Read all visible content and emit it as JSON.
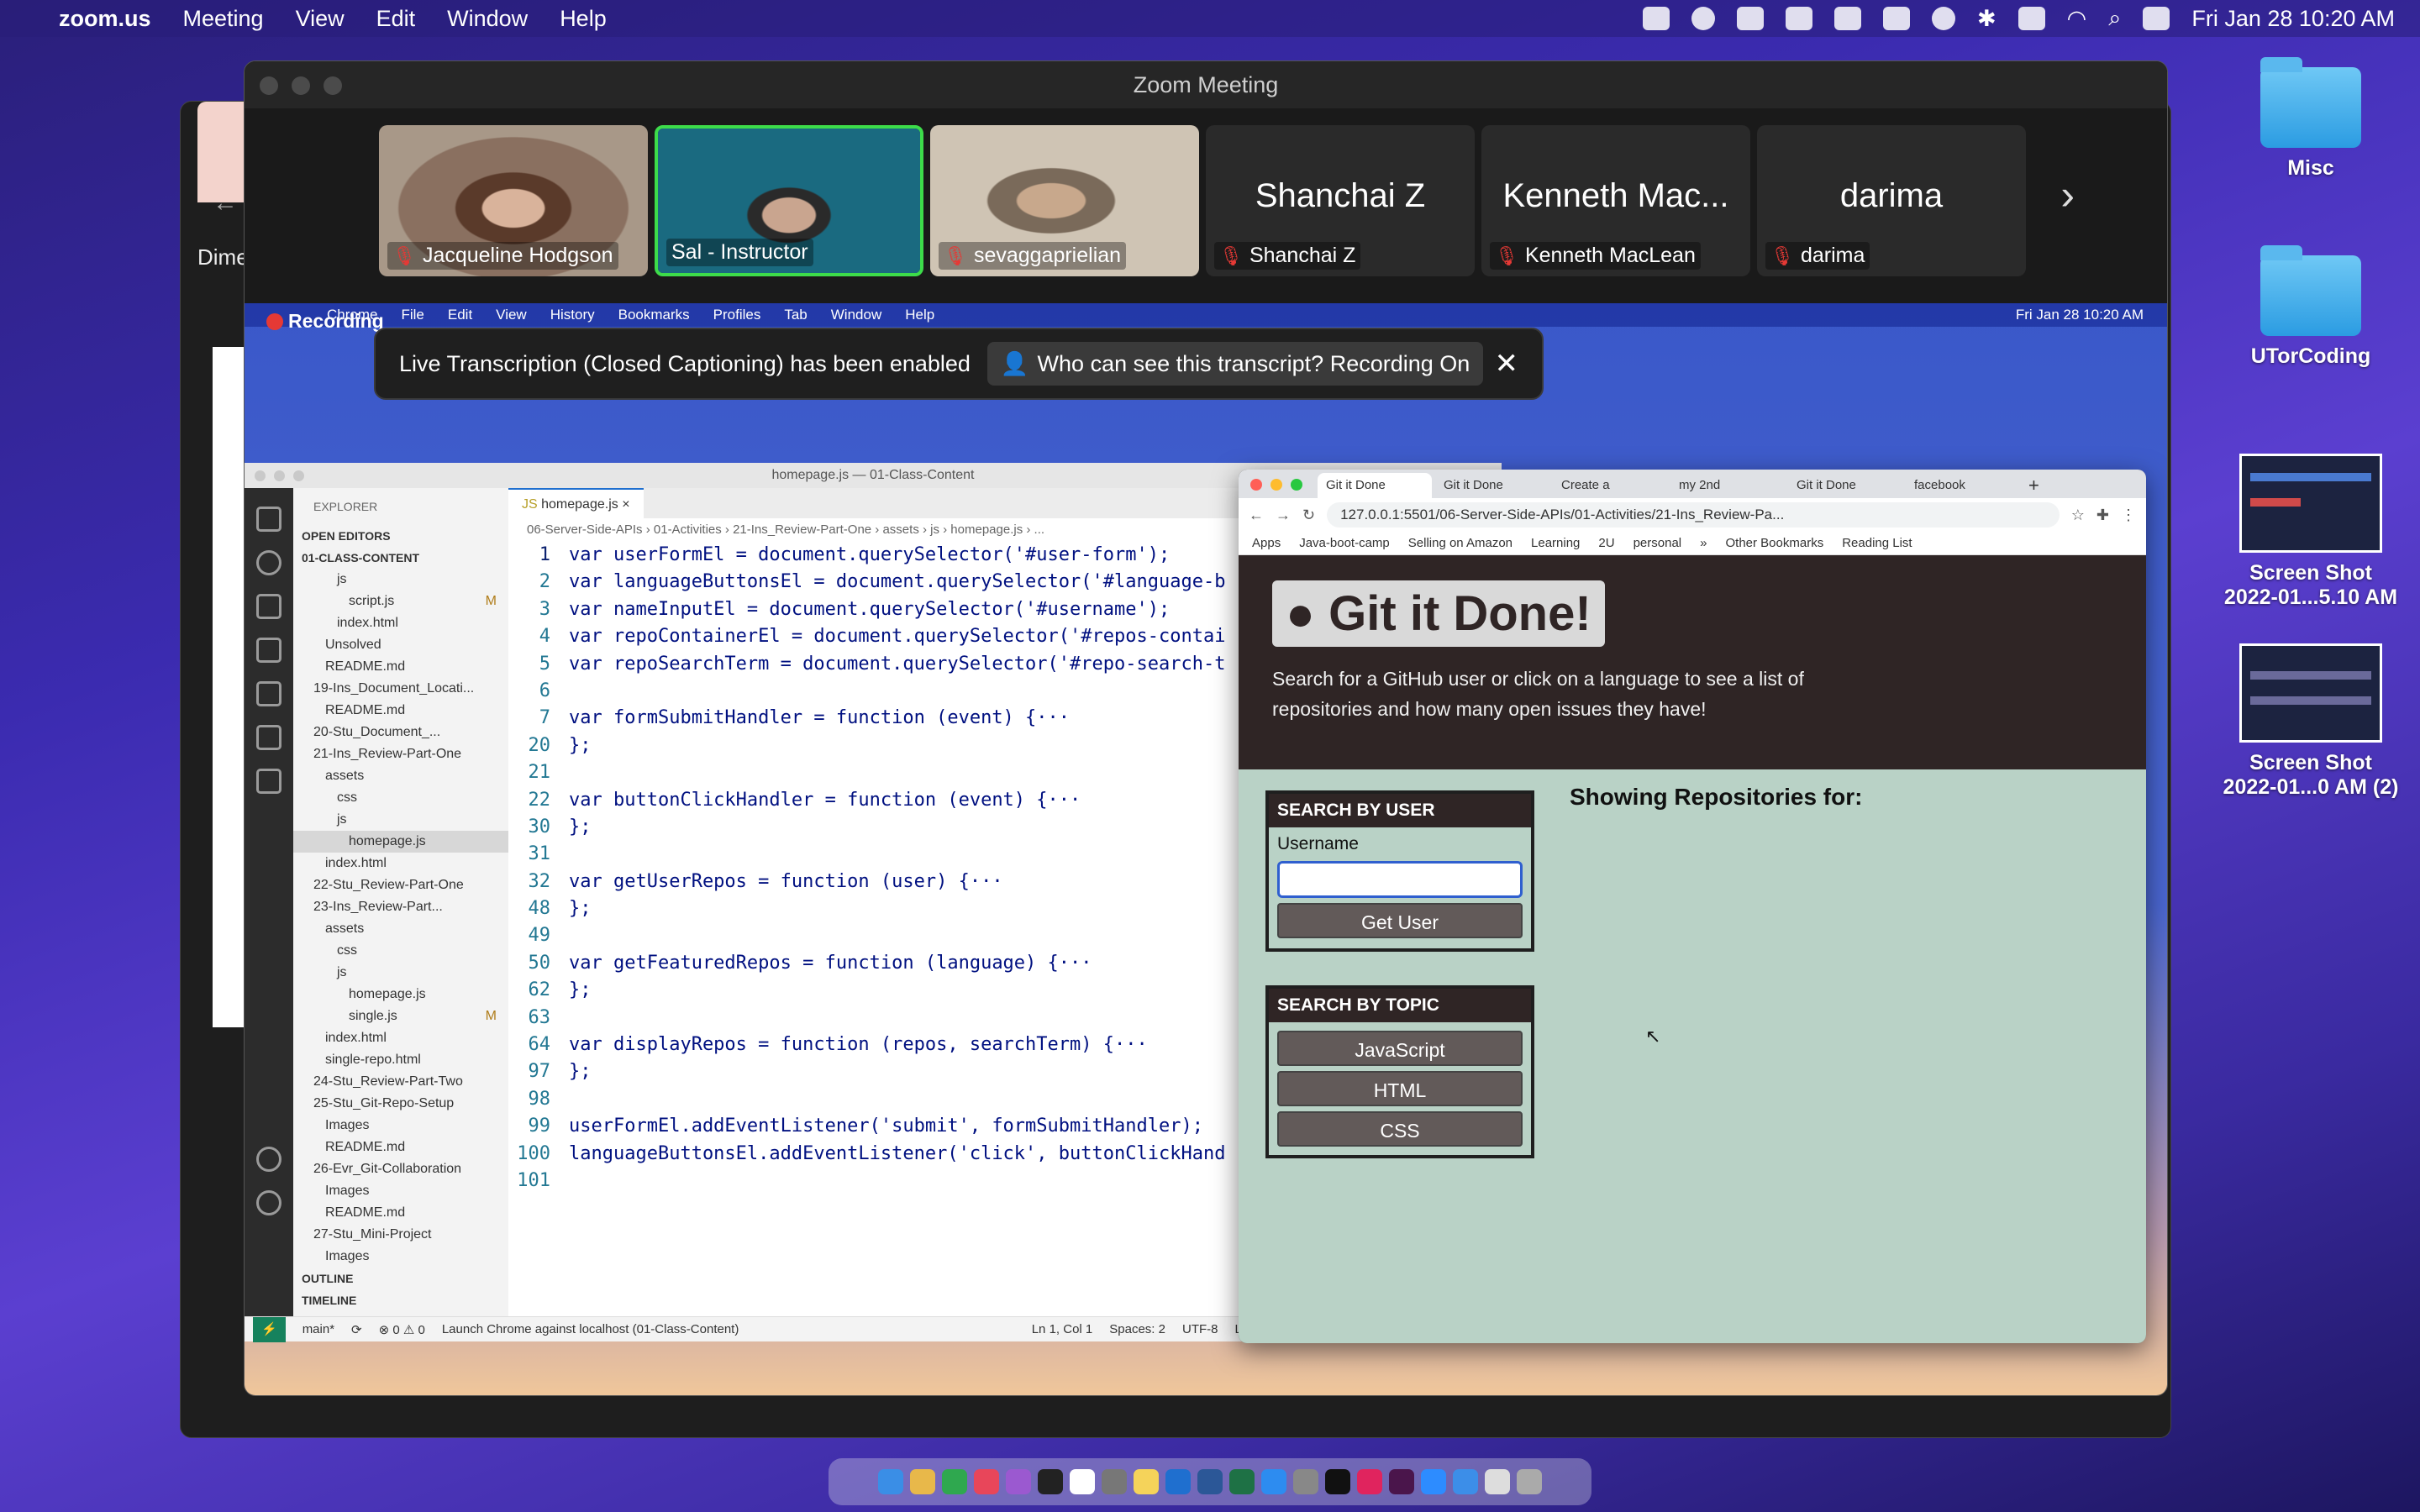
{
  "menubar": {
    "app": "zoom.us",
    "items": [
      "Meeting",
      "View",
      "Edit",
      "Window",
      "Help"
    ],
    "clock": "Fri Jan 28  10:20 AM"
  },
  "desktop": [
    {
      "label": "Misc",
      "kind": "folder"
    },
    {
      "label": "UTorCoding",
      "kind": "folder"
    },
    {
      "label_line1": "Screen Shot",
      "label_line2": "2022-01...5.10 AM",
      "kind": "screenshot"
    },
    {
      "label_line1": "Screen Shot",
      "label_line2": "2022-01...0 AM (2)",
      "kind": "screenshot"
    }
  ],
  "bg_window": {
    "fragment": "Dime"
  },
  "zoom": {
    "title": "Zoom Meeting",
    "participants": [
      {
        "name": "Jacqueline  Hodgson",
        "video": true
      },
      {
        "name": "Sal - Instructor",
        "video": true,
        "active": true
      },
      {
        "name": "sevaggaprielian",
        "video": true
      },
      {
        "name": "Shanchai Z",
        "display": "Shanchai Z"
      },
      {
        "name": "Kenneth MacLean",
        "display": "Kenneth Mac..."
      },
      {
        "name": "darima",
        "display": "darima"
      }
    ],
    "recording_label": "Recording",
    "banner": {
      "text": "Live Transcription (Closed Captioning) has been enabled",
      "pill": "Who can see this transcript? Recording On"
    }
  },
  "shared_menubar": {
    "items": [
      "Chrome",
      "File",
      "Edit",
      "View",
      "History",
      "Bookmarks",
      "Profiles",
      "Tab",
      "Window",
      "Help"
    ],
    "clock": "Fri Jan 28  10:20 AM"
  },
  "vscode": {
    "title": "homepage.js — 01-Class-Content",
    "explorer_header": "EXPLORER",
    "tab": "homepage.js",
    "breadcrumb": "06-Server-Side-APIs › 01-Activities › 21-Ins_Review-Part-One › assets › js › homepage.js › ...",
    "tree": [
      {
        "label": "OPEN EDITORS",
        "indent": 0,
        "section": true
      },
      {
        "label": "01-CLASS-CONTENT",
        "indent": 0,
        "section": true
      },
      {
        "label": "js",
        "indent": 3
      },
      {
        "label": "script.js",
        "indent": 4,
        "mark": "M"
      },
      {
        "label": "index.html",
        "indent": 3
      },
      {
        "label": "Unsolved",
        "indent": 2
      },
      {
        "label": "README.md",
        "indent": 2
      },
      {
        "label": "19-Ins_Document_Locati...",
        "indent": 1
      },
      {
        "label": "README.md",
        "indent": 2
      },
      {
        "label": "20-Stu_Document_...",
        "indent": 1
      },
      {
        "label": "21-Ins_Review-Part-One",
        "indent": 1
      },
      {
        "label": "assets",
        "indent": 2
      },
      {
        "label": "css",
        "indent": 3
      },
      {
        "label": "js",
        "indent": 3
      },
      {
        "label": "homepage.js",
        "indent": 4,
        "selected": true
      },
      {
        "label": "index.html",
        "indent": 2
      },
      {
        "label": "22-Stu_Review-Part-One",
        "indent": 1
      },
      {
        "label": "23-Ins_Review-Part...",
        "indent": 1
      },
      {
        "label": "assets",
        "indent": 2
      },
      {
        "label": "css",
        "indent": 3
      },
      {
        "label": "js",
        "indent": 3
      },
      {
        "label": "homepage.js",
        "indent": 4
      },
      {
        "label": "single.js",
        "indent": 4,
        "mark": "M"
      },
      {
        "label": "index.html",
        "indent": 2
      },
      {
        "label": "single-repo.html",
        "indent": 2
      },
      {
        "label": "24-Stu_Review-Part-Two",
        "indent": 1
      },
      {
        "label": "25-Stu_Git-Repo-Setup",
        "indent": 1
      },
      {
        "label": "Images",
        "indent": 2
      },
      {
        "label": "README.md",
        "indent": 2
      },
      {
        "label": "26-Evr_Git-Collaboration",
        "indent": 1
      },
      {
        "label": "Images",
        "indent": 2
      },
      {
        "label": "README.md",
        "indent": 2
      },
      {
        "label": "27-Stu_Mini-Project",
        "indent": 1
      },
      {
        "label": "Images",
        "indent": 2
      },
      {
        "label": "OUTLINE",
        "indent": 0,
        "section": true
      },
      {
        "label": "TIMELINE",
        "indent": 0,
        "section": true
      }
    ],
    "code": [
      {
        "n": "1",
        "t": "var userFormEl = document.querySelector('#user-form');"
      },
      {
        "n": "2",
        "t": "var languageButtonsEl = document.querySelector('#language-b"
      },
      {
        "n": "3",
        "t": "var nameInputEl = document.querySelector('#username');"
      },
      {
        "n": "4",
        "t": "var repoContainerEl = document.querySelector('#repos-contai"
      },
      {
        "n": "5",
        "t": "var repoSearchTerm = document.querySelector('#repo-search-t"
      },
      {
        "n": "6",
        "t": ""
      },
      {
        "n": "7",
        "t": "var formSubmitHandler = function (event) {···"
      },
      {
        "n": "20",
        "t": "};"
      },
      {
        "n": "21",
        "t": ""
      },
      {
        "n": "22",
        "t": "var buttonClickHandler = function (event) {···"
      },
      {
        "n": "30",
        "t": "};"
      },
      {
        "n": "31",
        "t": ""
      },
      {
        "n": "32",
        "t": "var getUserRepos = function (user) {···"
      },
      {
        "n": "48",
        "t": "};"
      },
      {
        "n": "49",
        "t": ""
      },
      {
        "n": "50",
        "t": "var getFeaturedRepos = function (language) {···"
      },
      {
        "n": "62",
        "t": "};"
      },
      {
        "n": "63",
        "t": ""
      },
      {
        "n": "64",
        "t": "var displayRepos = function (repos, searchTerm) {···"
      },
      {
        "n": "97",
        "t": "};"
      },
      {
        "n": "98",
        "t": ""
      },
      {
        "n": "99",
        "t": "userFormEl.addEventListener('submit', formSubmitHandler);"
      },
      {
        "n": "100",
        "t": "languageButtonsEl.addEventListener('click', buttonClickHand"
      },
      {
        "n": "101",
        "t": ""
      }
    ],
    "status": {
      "branch": "main*",
      "problems": "⊗ 0 ⚠ 0",
      "launch": "Launch Chrome against localhost (01-Class-Content)",
      "position": "Ln 1, Col 1",
      "spaces": "Spaces: 2",
      "encoding": "UTF-8",
      "eol": "LF"
    }
  },
  "chrome": {
    "tabs": [
      "Git it Done",
      "Git it Done",
      "Create a",
      "my 2nd",
      "Git it Done",
      "facebook"
    ],
    "url": "127.0.0.1:5501/06-Server-Side-APIs/01-Activities/21-Ins_Review-Pa...",
    "bookmarks": [
      "Apps",
      "Java-boot-camp",
      "Selling on Amazon",
      "Learning",
      "2U",
      "personal",
      "»",
      "Other Bookmarks",
      "Reading List"
    ],
    "page": {
      "logo": "Git it Done!",
      "description": "Search for a GitHub user or click on a language to see a list of repositories and how many open issues they have!",
      "user_card_title": "SEARCH BY USER",
      "username_label": "Username",
      "username_value": "",
      "get_user": "Get User",
      "topic_card_title": "SEARCH BY TOPIC",
      "topics": [
        "JavaScript",
        "HTML",
        "CSS"
      ],
      "showing": "Showing Repositories for:"
    }
  },
  "colors": {
    "active_speaker": "#3ddc4a",
    "muted_mic": "#e53935",
    "page_bg": "#b9d2c6",
    "hero_bg": "#2f2525"
  }
}
